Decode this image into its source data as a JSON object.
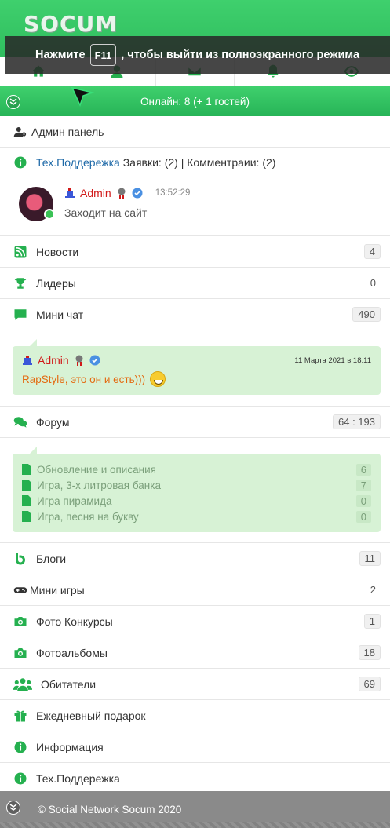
{
  "header": {
    "logo": "SOCUM",
    "nav_icons": [
      "home-icon",
      "user-icon",
      "mail-icon",
      "bell-icon",
      "eye-icon"
    ]
  },
  "overlay": {
    "before": "Нажмите",
    "key": "F11",
    "after": ", чтобы выйти из полноэкранного режима"
  },
  "online": {
    "text": "Онлайн: 8 (+ 1 гостей)"
  },
  "admin_panel": {
    "label": "Админ панель"
  },
  "support_line": {
    "link": "Тех.Поддережка",
    "text": " Заявки: (2) | Комментраии: (2)"
  },
  "user": {
    "name": "Admin",
    "time": "13:52:29",
    "status": "Заходит на сайт"
  },
  "menu_top": [
    {
      "label": "Новости",
      "count": "4",
      "icon": "rss-icon"
    },
    {
      "label": "Лидеры",
      "count": "0",
      "icon": "trophy-icon"
    },
    {
      "label": "Мини чат",
      "count": "490",
      "icon": "chat-icon"
    }
  ],
  "chat": {
    "author": "Admin",
    "date": "11 Марта 2021 в 18:11",
    "message": "RapStyle, это он и есть)))"
  },
  "forum": {
    "label": "Форум",
    "count": "64 : 193",
    "topics": [
      {
        "title": "Обновление и описания",
        "count": "6"
      },
      {
        "title": "Игра, 3-х литровая банка",
        "count": "7"
      },
      {
        "title": "Игра пирамида",
        "count": "0"
      },
      {
        "title": "Игра, песня на букву",
        "count": "0"
      }
    ]
  },
  "menu_bottom": [
    {
      "label": "Блоги",
      "count": "11",
      "icon": "blog-icon"
    },
    {
      "label": "Мини игры",
      "count": "2",
      "icon": "gamepad-icon"
    },
    {
      "label": "Фото Конкурсы",
      "count": "1",
      "icon": "camera-icon"
    },
    {
      "label": "Фотоальбомы",
      "count": "18",
      "icon": "camera-icon"
    },
    {
      "label": "Обитатели",
      "count": "69",
      "icon": "users-icon"
    },
    {
      "label": "Ежедневный подарок",
      "count": "",
      "icon": "gift-icon"
    },
    {
      "label": "Информация",
      "count": "",
      "icon": "info-icon"
    },
    {
      "label": "Тех.Поддережка",
      "count": "",
      "icon": "info-icon"
    }
  ],
  "footer": {
    "text": "© Social Network Socum 2020"
  },
  "colors": {
    "brand": "#2dbf5c",
    "admin": "#d11919",
    "chat_bg": "#d7f2d5"
  }
}
